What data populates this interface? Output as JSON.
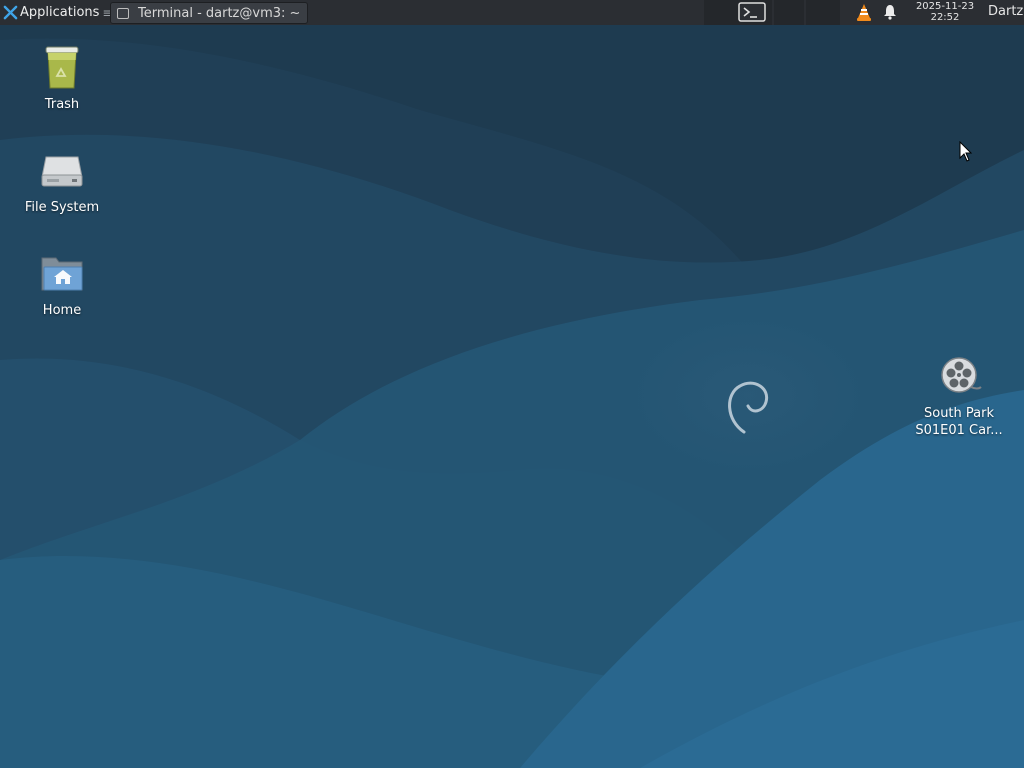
{
  "panel": {
    "applications_label": "Applications",
    "applications_trail": "≡",
    "task_title": "Terminal - dartz@vm3: ~",
    "clock_date": "2025-11-23",
    "clock_time": "22:52",
    "user": "Dartz"
  },
  "desktop": {
    "icons": [
      {
        "label": "Trash",
        "icon": "trash-icon"
      },
      {
        "label": "File System",
        "icon": "drive-icon"
      },
      {
        "label": "Home",
        "icon": "home-folder-icon"
      }
    ],
    "video_file": {
      "label_line1": "South Park",
      "label_line2": "S01E01 Car...",
      "icon": "video-reel-icon"
    }
  },
  "colors": {
    "panel_bg": "#2b2e33",
    "wallpaper_dark": "#1e3b50",
    "wallpaper_light": "#2a6890",
    "accent_vlc": "#f08a1c"
  }
}
